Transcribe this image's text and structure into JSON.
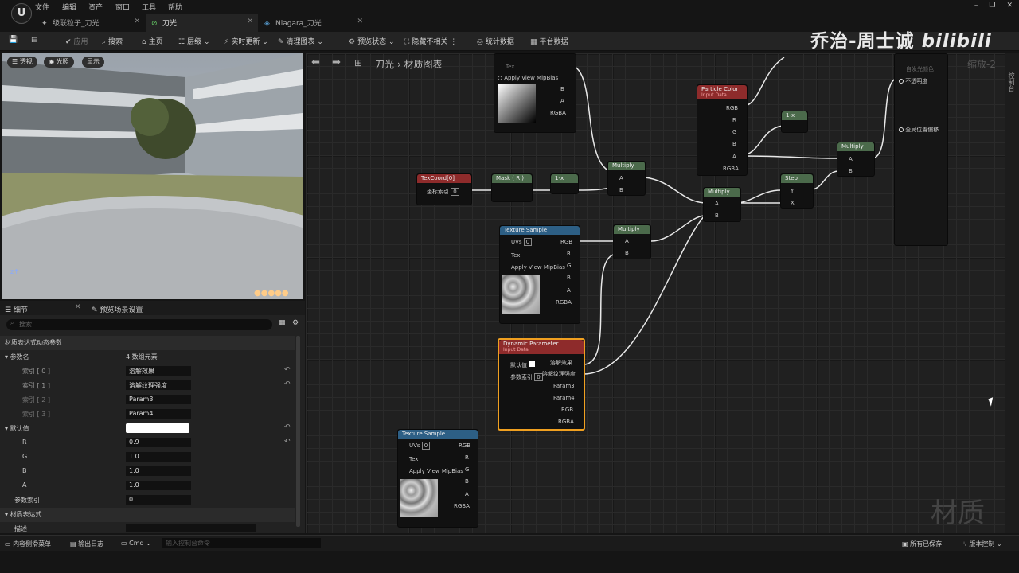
{
  "menu": {
    "items": [
      "文件",
      "编辑",
      "资产",
      "窗口",
      "工具",
      "帮助"
    ]
  },
  "tabs": [
    {
      "label": "级联粒子_刀光"
    },
    {
      "label": "刀光"
    },
    {
      "label": "Niagara_刀光"
    }
  ],
  "toolbar": {
    "apply": "应用",
    "search": "搜索",
    "home": "主页",
    "hierarchy": "层级",
    "live_update": "实时更新",
    "clean_graph": "清理图表",
    "preview_state": "预览状态",
    "hide_unrelated": "隐藏不相关",
    "stats": "统计数据",
    "platform_stats": "平台数据"
  },
  "watermark": {
    "text": "乔治-周士诚",
    "logo": "bilibili"
  },
  "viewport": {
    "perspective": "透视",
    "lit": "光照",
    "show": "显示"
  },
  "details": {
    "tab1": "细节",
    "tab2": "预览场景设置",
    "search_placeholder": "搜索",
    "section_params": "材质表达式动态参数",
    "param_names_label": "参数名",
    "param_names_count": "4 数组元素",
    "idx0": "索引 [ 0 ]",
    "val0": "溶解效果",
    "idx1": "索引 [ 1 ]",
    "val1": "溶解纹理强度",
    "idx2": "索引 [ 2 ]",
    "val2": "Param3",
    "idx3": "索引 [ 3 ]",
    "val3": "Param4",
    "default_label": "默认值",
    "r": "R",
    "r_val": "0.9",
    "g": "G",
    "g_val": "1.0",
    "b": "B",
    "b_val": "1.0",
    "a": "A",
    "a_val": "1.0",
    "param_index": "参数索引",
    "param_index_val": "0",
    "section_expr": "材质表达式",
    "desc": "描述"
  },
  "graph": {
    "breadcrumb1": "刀光",
    "breadcrumb2": "材质图表",
    "corner_label": "缩放-2",
    "right_tab": "控制台",
    "watermark2": "材质"
  },
  "nodes": {
    "texcoord": "TexCoord[0]",
    "coord_index": "坐标索引",
    "coord_index_val": "0",
    "mask": "Mask ( R )",
    "oneminus": "1-x",
    "multiply": "Multiply",
    "texsample": "Texture Sample",
    "uvs": "UVs",
    "uvs_val": "0",
    "tex": "Tex",
    "apply_mip": "Apply View MipBias",
    "rgb": "RGB",
    "r": "R",
    "g": "G",
    "b": "B",
    "a": "A",
    "rgba": "RGBA",
    "pin_a": "A",
    "pin_b": "B",
    "pin_x": "X",
    "pin_y": "Y",
    "particle_color": "Particle Color",
    "input_data": "Input Data",
    "step": "Step",
    "dyn_param": "Dynamic Parameter",
    "default_val": "默认值",
    "param_idx": "参数索引",
    "param_idx_val": "0",
    "out1": "溶解效果",
    "out2": "溶解纹理强度",
    "out3": "Param3",
    "out4": "Param4",
    "result_opacity": "不透明度",
    "result_wpo": "全局位置偏移",
    "result_emissive": "自发光颜色"
  },
  "statusbar": {
    "content_drawer": "内容侧滑菜单",
    "output_log": "输出日志",
    "cmd": "Cmd",
    "cmd_placeholder": "输入控制台命令",
    "saved": "所有已保存",
    "source_control": "版本控制"
  }
}
